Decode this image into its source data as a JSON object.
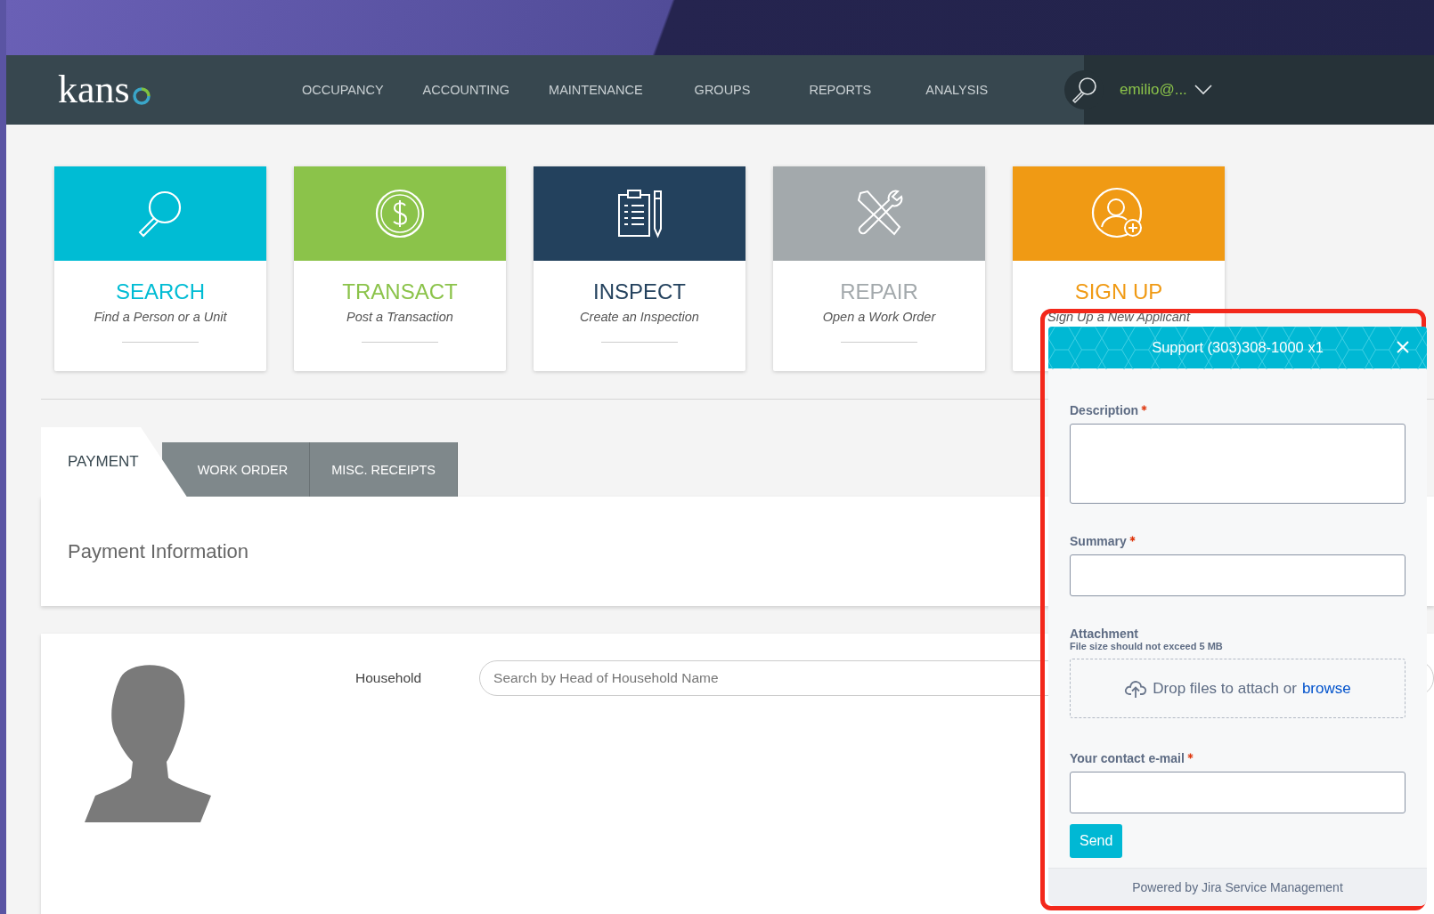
{
  "nav": {
    "logo": "kans",
    "items": [
      "OCCUPANCY",
      "ACCOUNTING",
      "MAINTENANCE",
      "GROUPS",
      "REPORTS",
      "ANALYSIS"
    ],
    "user": "emilio@..."
  },
  "cards": [
    {
      "kind": "search",
      "title": "SEARCH",
      "subtitle": "Find a Person or a Unit",
      "color": "#00bcd4"
    },
    {
      "kind": "transact",
      "title": "TRANSACT",
      "subtitle": "Post a Transaction",
      "color": "#8bc34a"
    },
    {
      "kind": "inspect",
      "title": "INSPECT",
      "subtitle": "Create an Inspection",
      "color": "#23415d"
    },
    {
      "kind": "repair",
      "title": "REPAIR",
      "subtitle": "Open a Work Order",
      "color": "#a3a9ac"
    },
    {
      "kind": "signup",
      "title": "SIGN UP",
      "subtitle": "Sign Up a New Applicant",
      "color": "#f09a14"
    }
  ],
  "tabs": [
    {
      "label": "PAYMENT",
      "selected": true
    },
    {
      "label": "WORK ORDER",
      "selected": false
    },
    {
      "label": "MISC. RECEIPTS",
      "selected": false
    }
  ],
  "payment_panel": {
    "title": "Payment Information"
  },
  "household": {
    "label": "Household",
    "placeholder": "Search by Head of Household Name"
  },
  "support_widget": {
    "title": "Support (303)308-1000 x1",
    "fields": [
      {
        "kind": "textarea",
        "label": "Description",
        "required": true
      },
      {
        "kind": "input",
        "label": "Summary",
        "required": true
      },
      {
        "kind": "dropzone",
        "label": "Attachment",
        "hint": "File size should not exceed 5 MB",
        "drop_text": "Drop files to attach or",
        "link": "browse"
      },
      {
        "kind": "input",
        "label": "Your contact e-mail",
        "required": true
      }
    ],
    "send": "Send",
    "footer": "Powered by Jira Service Management"
  }
}
